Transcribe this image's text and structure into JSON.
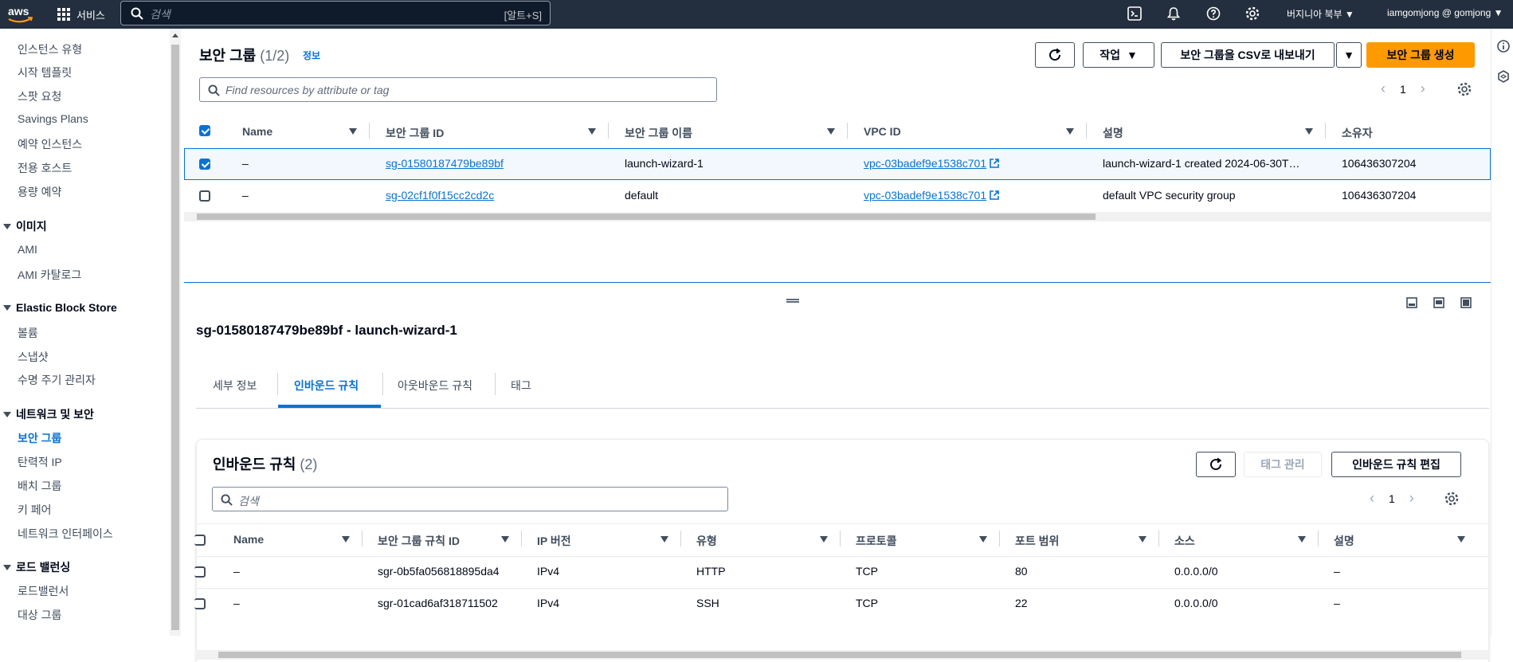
{
  "topbar": {
    "services_label": "서비스",
    "search_placeholder": "검색",
    "search_shortcut": "[알트+S]",
    "region": "버지니아 북부",
    "account": "iamgomjong @ gomjong"
  },
  "sidebar": {
    "items_top": [
      {
        "label": "인스턴스 유형"
      },
      {
        "label": "시작 템플릿"
      },
      {
        "label": "스팟 요청"
      },
      {
        "label": "Savings Plans"
      },
      {
        "label": "예약 인스턴스"
      },
      {
        "label": "전용 호스트"
      },
      {
        "label": "용량 예약"
      }
    ],
    "sections": [
      {
        "title": "이미지",
        "items": [
          {
            "label": "AMI"
          },
          {
            "label": "AMI 카탈로그"
          }
        ]
      },
      {
        "title": "Elastic Block Store",
        "items": [
          {
            "label": "볼륨"
          },
          {
            "label": "스냅샷"
          },
          {
            "label": "수명 주기 관리자"
          }
        ]
      },
      {
        "title": "네트워크 및 보안",
        "items": [
          {
            "label": "보안 그룹",
            "active": true
          },
          {
            "label": "탄력적 IP"
          },
          {
            "label": "배치 그룹"
          },
          {
            "label": "키 페어"
          },
          {
            "label": "네트워크 인터페이스"
          }
        ]
      },
      {
        "title": "로드 밸런싱",
        "items": [
          {
            "label": "로드밸런서"
          },
          {
            "label": "대상 그룹"
          }
        ]
      }
    ]
  },
  "sg_panel": {
    "title": "보안 그룹",
    "count": "(1/2)",
    "info": "정보",
    "actions_label": "작업",
    "export_label": "보안 그룹을 CSV로 내보내기",
    "create_label": "보안 그룹 생성",
    "filter_placeholder": "Find resources by attribute or tag",
    "page": "1",
    "columns": [
      "Name",
      "보안 그룹 ID",
      "보안 그룹 이름",
      "VPC ID",
      "설명",
      "소유자"
    ],
    "rows": [
      {
        "name": "–",
        "sg_id": "sg-01580187479be89bf",
        "sg_name": "launch-wizard-1",
        "vpc": "vpc-03badef9e1538c701",
        "desc": "launch-wizard-1 created 2024-06-30T…",
        "owner": "106436307204",
        "selected": true
      },
      {
        "name": "–",
        "sg_id": "sg-02cf1f0f15cc2cd2c",
        "sg_name": "default",
        "vpc": "vpc-03badef9e1538c701",
        "desc": "default VPC security group",
        "owner": "106436307204",
        "selected": false
      }
    ]
  },
  "detail": {
    "title": "sg-01580187479be89bf - launch-wizard-1",
    "tabs": [
      "세부 정보",
      "인바운드 규칙",
      "아웃바운드 규칙",
      "태그"
    ],
    "active_tab": 1
  },
  "inbound": {
    "title": "인바운드 규칙",
    "count": "(2)",
    "manage_tags_label": "태그 관리",
    "edit_label": "인바운드 규칙 편집",
    "search_placeholder": "검색",
    "page": "1",
    "columns": [
      "Name",
      "보안 그룹 규칙 ID",
      "IP 버전",
      "유형",
      "프로토콜",
      "포트 범위",
      "소스",
      "설명"
    ],
    "rows": [
      {
        "name": "–",
        "rule_id": "sgr-0b5fa056818895da4",
        "ip": "IPv4",
        "type": "HTTP",
        "proto": "TCP",
        "port": "80",
        "source": "0.0.0.0/0",
        "desc": "–"
      },
      {
        "name": "–",
        "rule_id": "sgr-01cad6af318711502",
        "ip": "IPv4",
        "type": "SSH",
        "proto": "TCP",
        "port": "22",
        "source": "0.0.0.0/0",
        "desc": "–"
      }
    ]
  },
  "colors": {
    "link": "#0972d3",
    "primary": "#ff9900",
    "topbar": "#232f3e"
  }
}
